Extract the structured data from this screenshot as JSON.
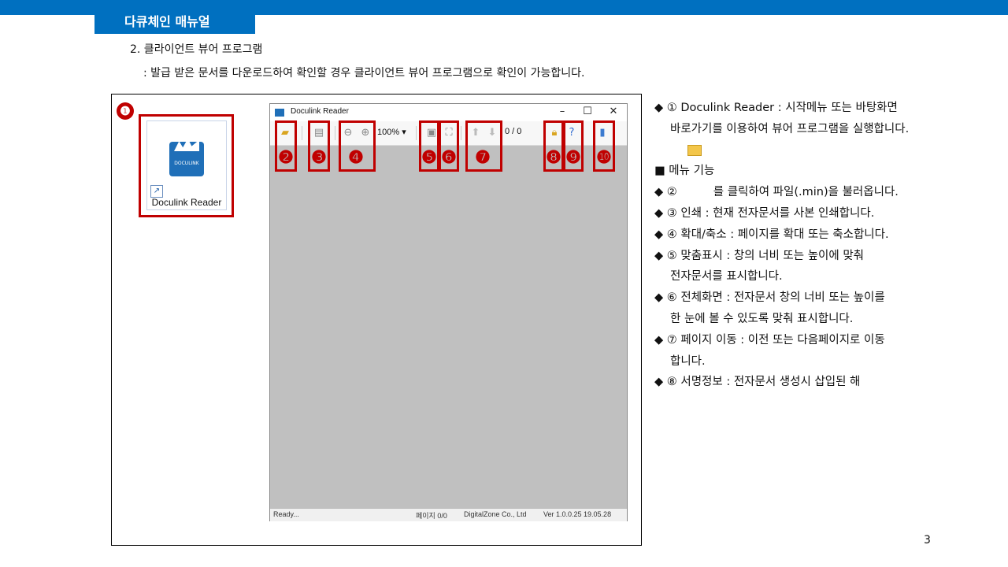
{
  "header": {
    "title": "다큐체인 매뉴얼"
  },
  "section": {
    "title": "2. 클라이언트 뷰어 프로그램",
    "description": ": 발급 받은 문서를 다운로드하여 확인할 경우 클라이언트 뷰어 프로그램으로 확인이 가능합니다."
  },
  "desktop_icon": {
    "badge": "❶",
    "label": "Docu​link Reader",
    "logo_text": "DOCULINK"
  },
  "viewer": {
    "title": "Doculink Reader",
    "controls": {
      "minimize": "–",
      "maximize": "☐",
      "close": "✕"
    },
    "zoom": "100% ▾",
    "page_counter": "0   / 0",
    "status": {
      "left": "Ready...",
      "page": "페이지 0/0",
      "company": "DigitalZone Co., Ltd",
      "version": "Ver 1.0.0.25   19.05.28"
    }
  },
  "callouts": {
    "n2": "❷",
    "n3": "❸",
    "n4": "❹",
    "n5": "❺",
    "n6": "❻",
    "n7": "❼",
    "n8": "❽",
    "n9": "❾",
    "n10": "❿"
  },
  "notes": {
    "l1a": "◆ ① Doculink Reader : 시작메뉴 또는 바탕화면",
    "l1b": "바로가기를 이용하여 뷰어 프로그램을 실행합니다.",
    "menu_heading": "■ 메뉴 기능",
    "l2a": "◆ ②",
    "l2b": "를 클릭하여 파일(.min)을 불러옵니다.",
    "l3": "◆ ③ 인쇄 : 현재 전자문서를 사본 인쇄합니다.",
    "l4": "◆ ④ 확대/축소 : 페이지를 확대 또는 축소합니다.",
    "l5a": "◆ ⑤ 맞춤표시 : 창의 너비 또는 높이에 맞춰",
    "l5b": "전자문서를 표시합니다.",
    "l6a": "◆ ⑥ 전체화면 : 전자문서 창의 너비 또는 높이를",
    "l6b": "한 눈에 볼 수 있도록 맞춰 표시합니다.",
    "l7a": "◆ ⑦ 페이지 이동 : 이전 또는 다음페이지로 이동",
    "l7b": "합니다.",
    "l8": "◆ ⑧ 서명정보 : 전자문서 생성시 삽입된 해"
  },
  "page_number": "3"
}
